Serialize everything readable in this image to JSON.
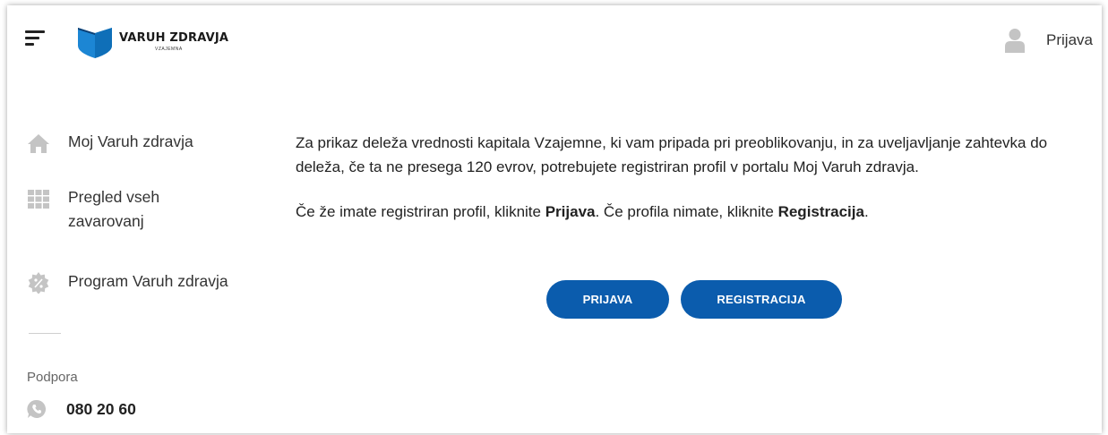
{
  "header": {
    "logo_text": "VARUH ZDRAVJA",
    "logo_subtext": "VZAJEMNA",
    "user_label": "Prijava",
    "icons": {
      "menu": "hamburger-menu-icon",
      "user": "user-icon",
      "logo": "shield-book-logo"
    }
  },
  "sidebar": {
    "items": [
      {
        "label": "Moj Varuh zdravja",
        "icon": "home-icon"
      },
      {
        "label_line1": "Pregled vseh",
        "label_line2": "zavarovanj",
        "icon": "grid-icon"
      },
      {
        "label": "Program Varuh zdravja",
        "icon": "badge-icon"
      }
    ],
    "support": {
      "title": "Podpora",
      "phone": "080 20 60",
      "icon": "phone-chat-icon"
    }
  },
  "main": {
    "paragraph1": "Za prikaz deleža vrednosti kapitala Vzajemne, ki vam pripada pri preoblikovanju, in za uveljavljanje zahtevka do deleža, če ta ne presega 120 evrov, potrebujete registriran profil v portalu Moj Varuh zdravja.",
    "paragraph2": {
      "prefix": "Če že imate registriran profil, kliknite ",
      "bold1": "Prijava",
      "middle": ". Če profila nimate, kliknite ",
      "bold2": "Registracija",
      "suffix": "."
    },
    "buttons": {
      "login": "PRIJAVA",
      "register": "REGISTRACIJA"
    }
  },
  "colors": {
    "primary": "#0b5cad",
    "logo_blue": "#1c86d4",
    "icon_gray": "#c4c4c4",
    "text": "#222222"
  }
}
